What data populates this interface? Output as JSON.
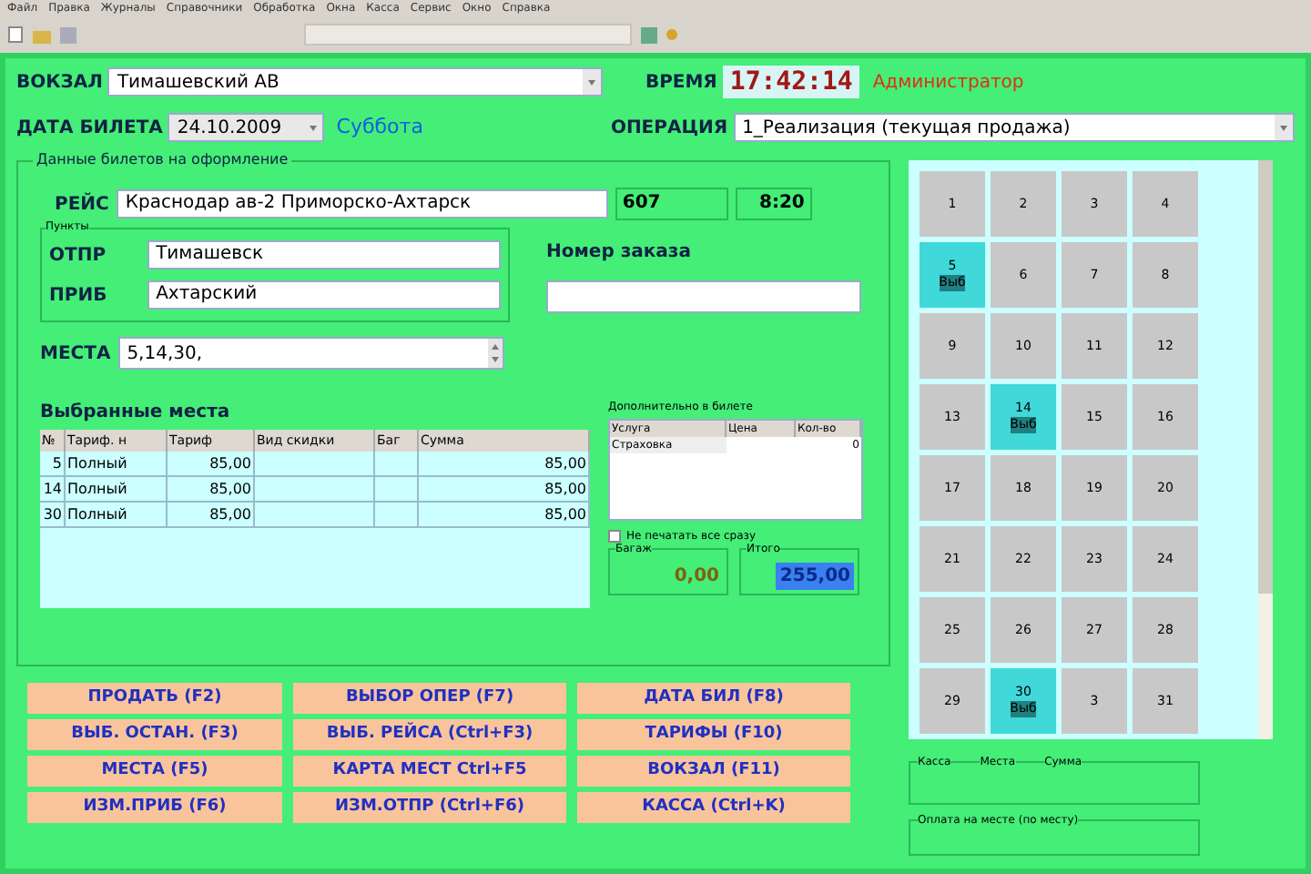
{
  "menu": [
    "Файл",
    "Правка",
    "Журналы",
    "Справочники",
    "Обработка",
    "Окна",
    "Касса",
    "Сервис",
    "Окно",
    "Справка"
  ],
  "station": {
    "label": "ВОКЗАЛ",
    "value": "Тимашевский АВ"
  },
  "time": {
    "label": "ВРЕМЯ",
    "value": "17:42:14"
  },
  "user": "Администратор",
  "ticket_date": {
    "label": "ДАТА БИЛЕТА",
    "value": "24.10.2009",
    "weekday": "Суббота"
  },
  "operation": {
    "label": "ОПЕРАЦИЯ",
    "value": "1_Реализация (текущая продажа)"
  },
  "group_title": "Данные билетов на оформление",
  "trip": {
    "label": "РЕЙС",
    "value": "Краснодар ав-2 Приморско-Ахтарск",
    "number": "607",
    "departure": "8:20"
  },
  "points": {
    "title": "Пункты",
    "from_label": "ОТПР",
    "from": "Тимашевск",
    "to_label": "ПРИБ",
    "to": "Ахтарский"
  },
  "order": {
    "label": "Номер заказа"
  },
  "seats_field": {
    "label": "МЕСТА",
    "value": "5,14,30,"
  },
  "selected_title": "Выбранные места",
  "table": {
    "columns": [
      "№",
      "Тариф. н",
      "Тариф",
      "Вид скидки",
      "Баг",
      "Сумма"
    ],
    "rows": [
      [
        "5",
        "Полный",
        "85,00",
        "",
        "",
        "85,00"
      ],
      [
        "14",
        "Полный",
        "85,00",
        "",
        "",
        "85,00"
      ],
      [
        "30",
        "Полный",
        "85,00",
        "",
        "",
        "85,00"
      ]
    ]
  },
  "extras": {
    "title": "Дополнительно в билете",
    "columns": [
      "Услуга",
      "Цена",
      "Кол-во"
    ],
    "rows": [
      [
        "Страховка",
        "",
        "0"
      ]
    ]
  },
  "no_print": {
    "label": "Не печатать все сразу",
    "checked": false
  },
  "baggage": {
    "label": "Багаж",
    "value": "0,00"
  },
  "total": {
    "label": "Итого",
    "value": "255,00"
  },
  "buttons": [
    "ПРОДАТЬ (F2)",
    "ВЫБОР ОПЕР (F7)",
    "ДАТА БИЛ (F8)",
    "ВЫБ. ОСТАН. (F3)",
    "ВЫБ. РЕЙСА (Ctrl+F3)",
    "ТАРИФЫ (F10)",
    "МЕСТА (F5)",
    "КАРТА МЕСТ Ctrl+F5",
    "ВОКЗАЛ (F11)",
    "ИЗМ.ПРИБ (F6)",
    "ИЗМ.ОТПР (Ctrl+F6)",
    "КАССА (Ctrl+K)"
  ],
  "seats": [
    {
      "number": "1",
      "selected": false
    },
    {
      "number": "2",
      "selected": false
    },
    {
      "number": "3",
      "selected": false
    },
    {
      "number": "4",
      "selected": false
    },
    {
      "number": "5",
      "selected": true,
      "note": "Выб"
    },
    {
      "number": "6",
      "selected": false
    },
    {
      "number": "7",
      "selected": false
    },
    {
      "number": "8",
      "selected": false
    },
    {
      "number": "9",
      "selected": false
    },
    {
      "number": "10",
      "selected": false
    },
    {
      "number": "11",
      "selected": false
    },
    {
      "number": "12",
      "selected": false
    },
    {
      "number": "13",
      "selected": false
    },
    {
      "number": "14",
      "selected": true,
      "note": "Выб"
    },
    {
      "number": "15",
      "selected": false
    },
    {
      "number": "16",
      "selected": false
    },
    {
      "number": "17",
      "selected": false
    },
    {
      "number": "18",
      "selected": false
    },
    {
      "number": "19",
      "selected": false
    },
    {
      "number": "20",
      "selected": false
    },
    {
      "number": "21",
      "selected": false
    },
    {
      "number": "22",
      "selected": false
    },
    {
      "number": "23",
      "selected": false
    },
    {
      "number": "24",
      "selected": false
    },
    {
      "number": "25",
      "selected": false
    },
    {
      "number": "26",
      "selected": false
    },
    {
      "number": "27",
      "selected": false
    },
    {
      "number": "28",
      "selected": false
    },
    {
      "number": "29",
      "selected": false
    },
    {
      "number": "30",
      "selected": true,
      "note": "Выб"
    },
    {
      "number": "3",
      "selected": false
    },
    {
      "number": "31",
      "selected": false
    }
  ],
  "cash_group": {
    "columns": [
      "Касса",
      "Места",
      "Сумма"
    ]
  },
  "bottom_group": {
    "title": "Оплата на месте (по месту)"
  }
}
